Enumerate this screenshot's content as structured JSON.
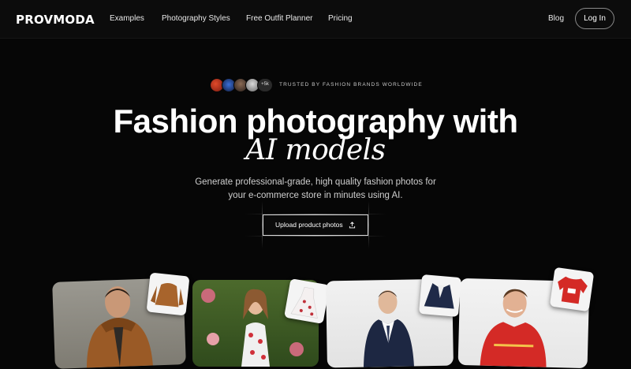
{
  "nav": {
    "logo": "PROVMODA",
    "links": [
      "Examples",
      "Photography Styles",
      "Free Outfit Planner",
      "Pricing"
    ],
    "blog": "Blog",
    "login": "Log In"
  },
  "hero": {
    "avatar_more": "+5k",
    "trusted": "TRUSTED BY FASHION BRANDS WORLDWIDE",
    "title_line1": "Fashion photography with",
    "title_line2": "AI models",
    "subtitle": "Generate professional-grade, high quality fashion photos for your e-commerce store in minutes using AI.",
    "cta": "Upload product photos"
  },
  "icons": [
    "upload-icon"
  ],
  "colors": {
    "background": "#060606",
    "text": "#ffffff",
    "subtext": "#cfcfcf"
  },
  "cards": [
    {
      "name": "model-brown-jacket",
      "garment": "brown hooded jacket"
    },
    {
      "name": "model-floral-dress",
      "garment": "floral dress"
    },
    {
      "name": "model-navy-suit",
      "garment": "navy suit jacket"
    },
    {
      "name": "model-red-sweater",
      "garment": "red sweater"
    }
  ]
}
